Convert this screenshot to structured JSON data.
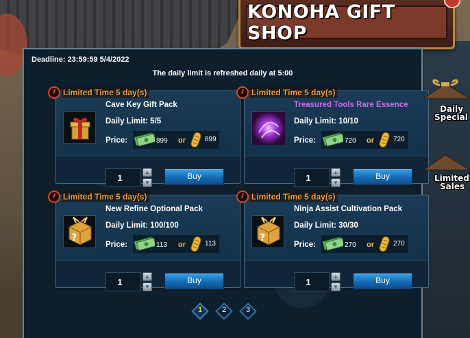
{
  "shop": {
    "title": "KONOHA GIFT SHOP",
    "deadline": "Deadline: 23:59:59 5/4/2022",
    "refresh_note": "The daily limit is refreshed daily at 5:00"
  },
  "items": [
    {
      "limited": "Limited Time 5 day(s)",
      "name": "Cave Key Gift Pack",
      "daily_limit": "Daily Limit: 5/5",
      "price_label": "Price:",
      "price_cash": "899",
      "or": "or",
      "price_coin": "899",
      "quantity": "1",
      "buy": "Buy",
      "icon": "gift-box-icon"
    },
    {
      "limited": "Limited Time 5 day(s)",
      "name": "Treasured Tools Rare Essence",
      "daily_limit": "Daily Limit: 10/10",
      "price_label": "Price:",
      "price_cash": "720",
      "or": "or",
      "price_coin": "720",
      "quantity": "1",
      "buy": "Buy",
      "icon": "purple-essence-icon"
    },
    {
      "limited": "Limited Time 5 day(s)",
      "name": "New Refine Optional Pack",
      "daily_limit": "Daily Limit: 100/100",
      "price_label": "Price:",
      "price_cash": "113",
      "or": "or",
      "price_coin": "113",
      "quantity": "1",
      "buy": "Buy",
      "icon": "mystery-box-icon"
    },
    {
      "limited": "Limited Time 5 day(s)",
      "name": "Ninja Assist Cultivation Pack",
      "daily_limit": "Daily Limit: 30/30",
      "price_label": "Price:",
      "price_cash": "270",
      "or": "or",
      "price_coin": "270",
      "quantity": "1",
      "buy": "Buy",
      "icon": "mystery-box-icon"
    }
  ],
  "pagination": {
    "pages": [
      "1",
      "2",
      "3"
    ],
    "current": "1"
  },
  "side": {
    "daily_special_1": "Daily",
    "daily_special_2": "Special",
    "limited_sales_1": "Limited",
    "limited_sales_2": "Sales"
  },
  "colors": {
    "panel_bg": "#0d1e2c",
    "limited_text": "#f39c3a",
    "rare_name": "#c86de8",
    "buy_button": "#1569b5",
    "header_red": "#7b3a2a"
  }
}
